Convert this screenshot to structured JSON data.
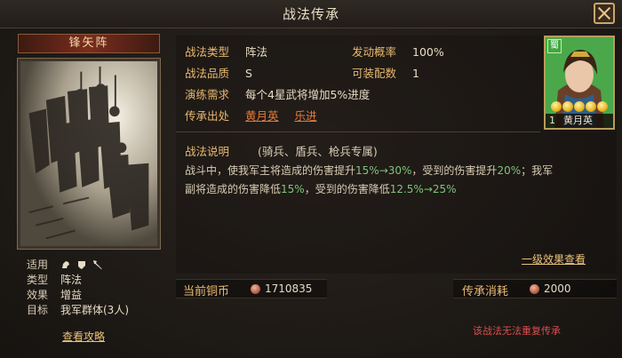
{
  "window": {
    "title": "战法传承"
  },
  "skill": {
    "name": "锋矢阵",
    "info": {
      "applicable_label": "适用",
      "type_label": "类型",
      "type_value": "阵法",
      "effect_label": "效果",
      "effect_value": "增益",
      "target_label": "目标",
      "target_value": "我军群体(3人)"
    },
    "applicable_icons": [
      "cavalry-icon",
      "shield-icon",
      "spear-icon"
    ],
    "strategy_link": "查看攻略"
  },
  "attributes": {
    "type_label": "战法类型",
    "type_value": "阵法",
    "trigger_label": "发动概率",
    "trigger_value": "100%",
    "quality_label": "战法品质",
    "quality_value": "S",
    "equip_label": "可装配数",
    "equip_value": "1",
    "practice_label": "演练需求",
    "practice_value": "每个4星武将增加5%进度",
    "origin_label": "传承出处",
    "origin_heroes": [
      "黄月英",
      "乐进"
    ]
  },
  "description": {
    "title": "战法说明",
    "subtitle": "(骑兵、盾兵、枪兵专属)",
    "line1_a": "战斗中，使我军主将造成的伤害提升",
    "line1_b": "15%→30%",
    "line1_c": "，受到的伤害提升",
    "line1_d": "20%",
    "line1_e": "；我军",
    "line2_a": "副将造成的伤害降低",
    "line2_b": "15%",
    "line2_c": "，受到的伤害降低",
    "line2_d": "12.5%→25%"
  },
  "effect_link": "一级效果查看",
  "hero": {
    "faction": "蜀",
    "level": "1",
    "name": "黄月英",
    "stars": 5
  },
  "currency": {
    "label": "当前铜币",
    "value": "1710835"
  },
  "cost": {
    "label": "传承消耗",
    "value": "2000"
  },
  "warning": "该战法无法重复传承",
  "colors": {
    "accent_gold": "#e8b870",
    "link_orange": "#e27a3a",
    "positive_green": "#7ec47a",
    "warning_red": "#d84f4f"
  }
}
